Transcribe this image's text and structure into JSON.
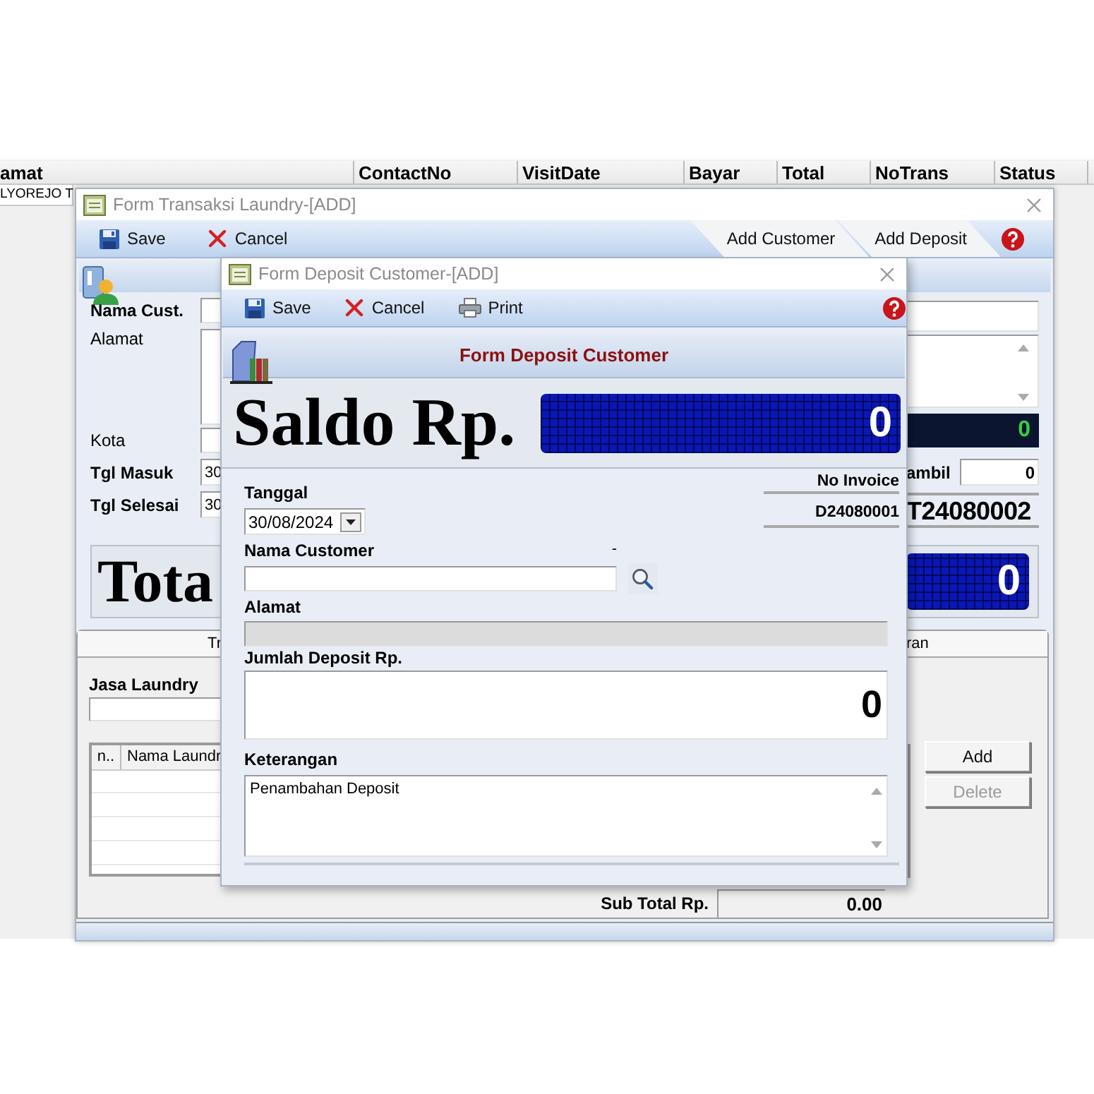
{
  "background_table": {
    "columns": [
      "amat",
      "ContactNo",
      "VisitDate",
      "Bayar",
      "Total",
      "NoTrans",
      "Status"
    ],
    "rows": [
      {
        "cells": [
          "LYOREJO T"
        ]
      }
    ]
  },
  "transaction_window": {
    "title": "Form Transaksi Laundry-[ADD]",
    "toolbar": [
      {
        "label": "Save",
        "kind": "save"
      },
      {
        "label": "Cancel",
        "kind": "cancel"
      }
    ],
    "tab_buttons": [
      {
        "label": "Add Customer"
      },
      {
        "label": "Add Deposit"
      }
    ],
    "customer_fields": [
      {
        "label": "Nama Cust.",
        "bold": true,
        "kind": "text"
      },
      {
        "label": "Alamat",
        "bold": false,
        "kind": "textarea"
      },
      {
        "label": "Kota",
        "bold": false,
        "kind": "text"
      },
      {
        "label": "Tgl Masuk",
        "bold": true,
        "kind": "text",
        "value": "30"
      },
      {
        "label": "Tgl Selesai",
        "bold": true,
        "kind": "text",
        "value": "30"
      }
    ],
    "right_panel": {
      "balance_display": "0",
      "pickup_label": "ambil",
      "pickup_value": "0",
      "invoice": "T24080002"
    },
    "total": {
      "label": "Tota",
      "value": "0"
    },
    "tabs": [
      {
        "label": "Tr"
      },
      {
        "label": "ran"
      }
    ],
    "service_label": "Jasa Laundry",
    "items_table": {
      "columns": [
        "n..",
        "Nama Laundr"
      ]
    },
    "buttons": [
      {
        "label": "Add",
        "disabled": false
      },
      {
        "label": "Delete",
        "disabled": true
      }
    ],
    "subtotal": {
      "label": "Sub Total Rp.",
      "value": "0.00"
    }
  },
  "deposit_dialog": {
    "title": "Form Deposit Customer-[ADD]",
    "toolbar": [
      {
        "label": "Save",
        "kind": "save"
      },
      {
        "label": "Cancel",
        "kind": "cancel"
      },
      {
        "label": "Print",
        "kind": "print"
      }
    ],
    "heading": "Form Deposit Customer",
    "saldo_label": "Saldo Rp.",
    "saldo_value": "0",
    "invoice_label": "No Invoice",
    "invoice": "D24080001",
    "date": {
      "label": "Tanggal",
      "value": "30/08/2024"
    },
    "customer": {
      "label": "Nama Customer",
      "marker": "-"
    },
    "address": {
      "label": "Alamat",
      "disabled": true
    },
    "amount": {
      "label": "Jumlah Deposit Rp.",
      "value": "0"
    },
    "note": {
      "label": "Keterangan",
      "value": "Penambahan Deposit"
    }
  }
}
